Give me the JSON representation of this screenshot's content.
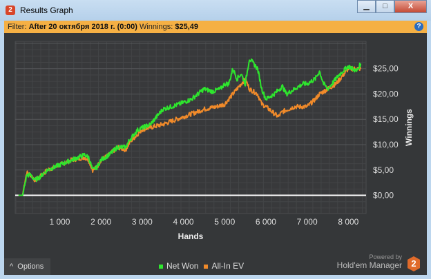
{
  "window": {
    "title": "Results Graph",
    "icon_text": "2",
    "minimize": "▁",
    "maximize": "□",
    "close": "X"
  },
  "filter": {
    "label": "Filter:",
    "value": "After 20 октября 2018 г. (0:00)",
    "winnings_label": "Winnings:",
    "winnings_value": "$25,49",
    "help": "?"
  },
  "options_label": "Options",
  "options_icon": "^",
  "brand": {
    "powered": "Powered by",
    "name": "Hold'em Manager",
    "logo": "2"
  },
  "colors": {
    "net_won": "#2ee62e",
    "all_in_ev": "#f08a2a",
    "zero_line": "#ffffff",
    "grid": "#4a4c4e"
  },
  "chart_data": {
    "type": "line",
    "xlabel": "Hands",
    "ylabel": "Winnings",
    "xlim": [
      -80,
      8430
    ],
    "ylim": [
      -3.6,
      30.4
    ],
    "xticks": [
      1000,
      2000,
      3000,
      4000,
      5000,
      6000,
      7000,
      8000
    ],
    "xtick_labels": [
      "1 000",
      "2 000",
      "3 000",
      "4 000",
      "5 000",
      "6 000",
      "7 000",
      "8 000"
    ],
    "yticks": [
      0,
      5,
      10,
      15,
      20,
      25
    ],
    "ytick_labels": [
      "$0,00",
      "$5,00",
      "$10,00",
      "$15,00",
      "$20,00",
      "$25,00"
    ],
    "legend": [
      "Net Won",
      "All-In EV"
    ],
    "legend_position": "bottom-center",
    "grid": true,
    "series": [
      {
        "name": "Net Won",
        "x": [
          0,
          100,
          150,
          200,
          300,
          400,
          500,
          700,
          1000,
          1300,
          1600,
          1700,
          1800,
          1900,
          2000,
          2200,
          2400,
          2600,
          2700,
          2900,
          3200,
          3500,
          3900,
          4200,
          4500,
          4700,
          4900,
          5000,
          5100,
          5200,
          5300,
          5400,
          5500,
          5600,
          5700,
          5800,
          5900,
          6000,
          6200,
          6400,
          6500,
          6700,
          6900,
          7000,
          7200,
          7300,
          7400,
          7500,
          7600,
          7800,
          8000,
          8200,
          8300
        ],
        "y": [
          0,
          0,
          2,
          4,
          4,
          3,
          3.5,
          5,
          6,
          7,
          8,
          7.5,
          5,
          5.5,
          7,
          8,
          9.5,
          9.5,
          11,
          13,
          14,
          17,
          18,
          19,
          21,
          20.5,
          21,
          22,
          22,
          25,
          23,
          24,
          22,
          27,
          26,
          25,
          21,
          19,
          20,
          21.5,
          20,
          21,
          22,
          22,
          23,
          24.5,
          22,
          21,
          22,
          24,
          25.5,
          24.5,
          26
        ]
      },
      {
        "name": "All-In EV",
        "x": [
          0,
          100,
          150,
          200,
          300,
          400,
          500,
          700,
          1000,
          1300,
          1600,
          1700,
          1800,
          1900,
          2000,
          2200,
          2400,
          2600,
          2700,
          3000,
          3500,
          4000,
          4500,
          4800,
          5000,
          5100,
          5300,
          5500,
          5600,
          5800,
          5900,
          6000,
          6300,
          6400,
          6700,
          7000,
          7200,
          7300,
          7500,
          7700,
          8000,
          8300
        ],
        "y": [
          0,
          0,
          2.5,
          4.5,
          4,
          3,
          3.5,
          5,
          6,
          7,
          7.5,
          7,
          5,
          5.5,
          7,
          8,
          9.5,
          9,
          10.5,
          13,
          14,
          15.5,
          17,
          17.5,
          18,
          19,
          21,
          23,
          21,
          20,
          18,
          17.5,
          15.5,
          16.5,
          17.5,
          17.5,
          19,
          20,
          21,
          22,
          25,
          25
        ]
      }
    ]
  }
}
